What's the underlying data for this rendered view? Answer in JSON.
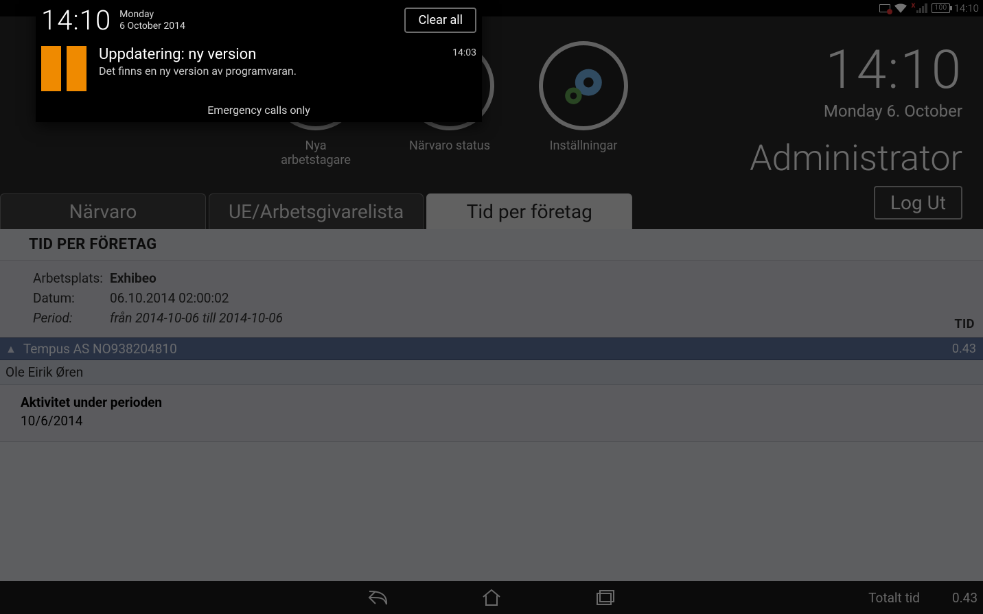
{
  "status_bar": {
    "battery": "100",
    "clock": "14:10",
    "signal_badge": "x"
  },
  "header": {
    "time": "14:10",
    "date": "Monday 6. October",
    "role": "Administrator",
    "logout": "Log Ut"
  },
  "round_buttons": [
    {
      "label": "Nya arbetstagare"
    },
    {
      "label": "Närvaro status"
    },
    {
      "label": "Inställningar"
    }
  ],
  "tabs": [
    {
      "label": "Närvaro",
      "active": false
    },
    {
      "label": "UE/Arbetsgivarelista",
      "active": false
    },
    {
      "label": "Tid per företag",
      "active": true
    }
  ],
  "panel": {
    "heading": "TID PER FÖRETAG",
    "meta": {
      "workplace_label": "Arbetsplats:",
      "workplace_value": "Exhibeo",
      "date_label": "Datum:",
      "date_value": "06.10.2014 02:00:02",
      "period_label": "Period:",
      "period_value": "från 2014-10-06 till 2014-10-06",
      "tid_header": "TID"
    },
    "company": {
      "name": "Tempus AS NO938204810",
      "tid": "0.43"
    },
    "person": {
      "name": "Ole Eirik Øren"
    },
    "activity": {
      "title": "Aktivitet under perioden",
      "date": "10/6/2014"
    },
    "totals": {
      "label": "Totalt tid",
      "value": "0.43"
    }
  },
  "shade": {
    "time": "14:10",
    "weekday": "Monday",
    "fulldate": "6 October 2014",
    "clear": "Clear all",
    "notif": {
      "title": "Uppdatering: ny version",
      "subtitle": "Det finns en ny version av programvaran.",
      "timestamp": "14:03"
    },
    "footer": "Emergency calls only"
  }
}
